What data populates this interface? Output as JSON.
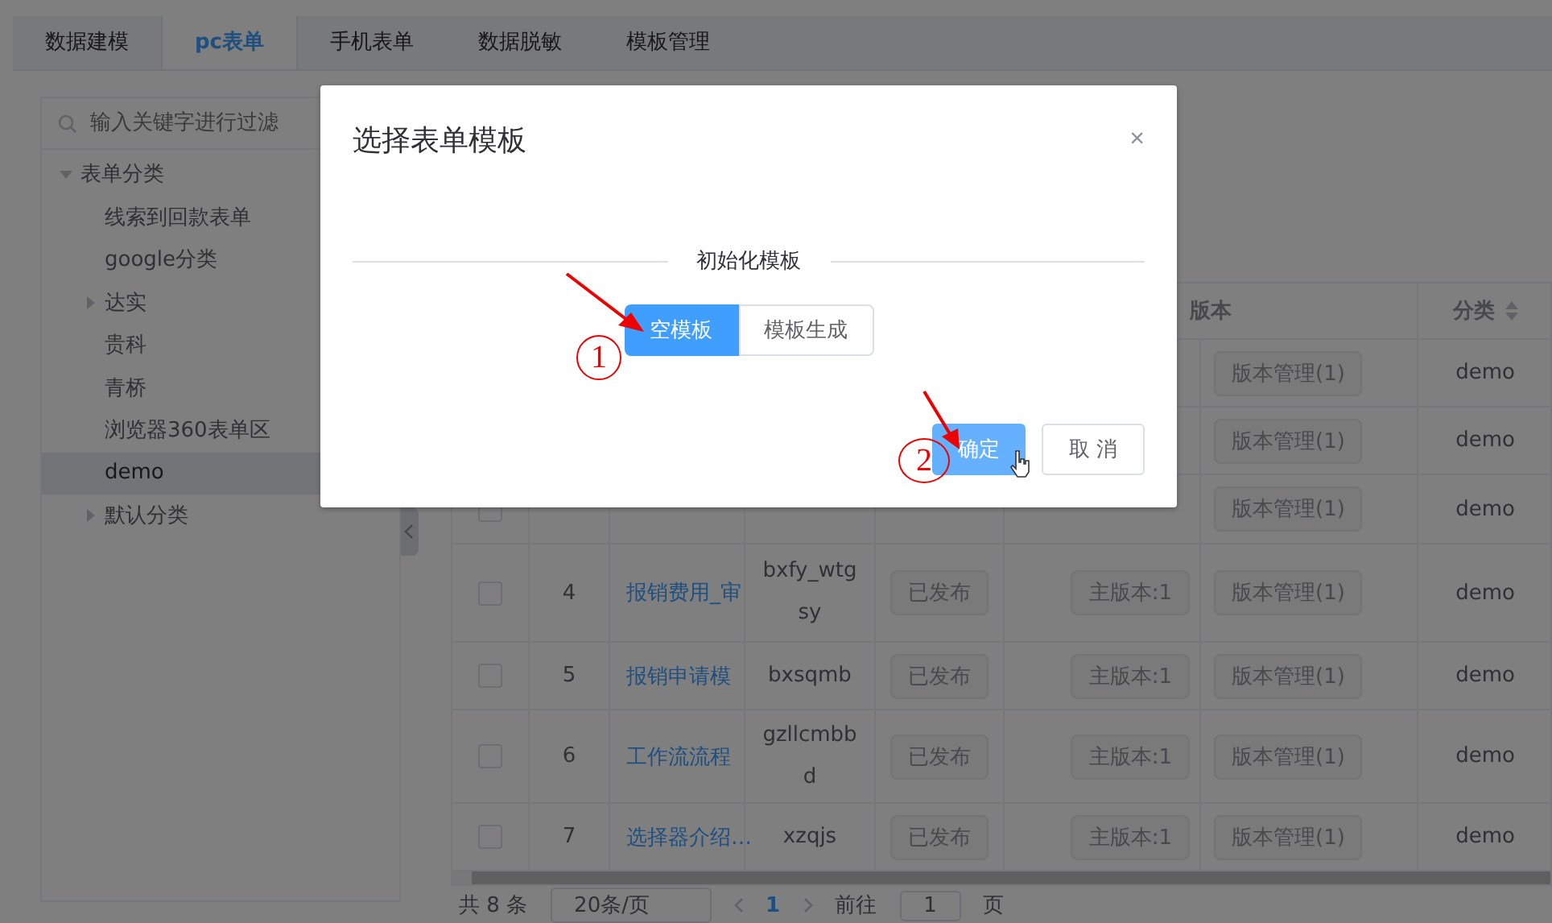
{
  "tabs": [
    {
      "label": "数据建模",
      "selected": false
    },
    {
      "label": "pc表单",
      "selected": true
    },
    {
      "label": "手机表单",
      "selected": false
    },
    {
      "label": "数据脱敏",
      "selected": false
    },
    {
      "label": "模板管理",
      "selected": false
    }
  ],
  "sidebar": {
    "search": {
      "placeholder": "输入关键字进行过滤"
    },
    "tree": [
      {
        "label": "表单分类",
        "expanded": true,
        "selected": false,
        "children": [
          {
            "label": "线索到回款表单",
            "selected": false
          },
          {
            "label": "google分类",
            "selected": false
          },
          {
            "label": "达实",
            "expanded": false,
            "selected": false
          },
          {
            "label": "贵科",
            "selected": false
          },
          {
            "label": "青桥",
            "selected": false
          },
          {
            "label": "浏览器360表单区",
            "selected": false
          },
          {
            "label": "demo",
            "selected": true
          },
          {
            "label": "默认分类",
            "expanded": false,
            "selected": false
          }
        ]
      }
    ]
  },
  "table": {
    "columns": [
      {
        "label": "版本"
      },
      {
        "label": "分类"
      }
    ],
    "rows": [
      {
        "version_manage": "版本管理(1)",
        "category": "demo"
      },
      {
        "version_manage": "版本管理(1)",
        "category": "demo"
      },
      {
        "version_manage": "版本管理(1)",
        "category": "demo"
      },
      {
        "checked": false,
        "index": "4",
        "name": "报销费用_审",
        "code": "bxfy_wtgsy",
        "status": "已发布",
        "main_version": "主版本:1",
        "version_manage": "版本管理(1)",
        "category": "demo"
      },
      {
        "checked": false,
        "index": "5",
        "name": "报销申请模",
        "code": "bxsqmb",
        "status": "已发布",
        "main_version": "主版本:1",
        "version_manage": "版本管理(1)",
        "category": "demo"
      },
      {
        "checked": false,
        "index": "6",
        "name": "工作流流程",
        "code": "gzllcmbbd",
        "status": "已发布",
        "main_version": "主版本:1",
        "version_manage": "版本管理(1)",
        "category": "demo"
      },
      {
        "checked": false,
        "index": "7",
        "name": "选择器介绍…",
        "code": "xzqjs",
        "status": "已发布",
        "main_version": "主版本:1",
        "version_manage": "版本管理(1)",
        "category": "demo"
      }
    ]
  },
  "pagination": {
    "total": "共 8 条",
    "page_size": "20条/页",
    "pages": [
      {
        "label": "1",
        "selected": true
      }
    ],
    "goto_label": "前往",
    "goto_value": "1",
    "goto_unit": "页"
  },
  "dialog": {
    "title": "选择表单模板",
    "close": "×",
    "section": "初始化模板",
    "options": [
      {
        "label": "空模板",
        "selected": true
      },
      {
        "label": "模板生成",
        "selected": false
      }
    ],
    "buttons": [
      {
        "label": "确定",
        "kind": "primary"
      },
      {
        "label": "取 消",
        "kind": "default"
      }
    ]
  },
  "annotations": [
    {
      "number": "1"
    },
    {
      "number": "2"
    }
  ]
}
